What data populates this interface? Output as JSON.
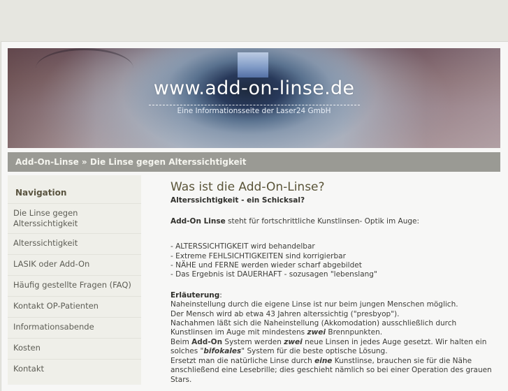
{
  "header": {
    "site_title": "www.add-on-linse.de",
    "site_subtitle": "Eine Informationsseite der Laser24 GmbH"
  },
  "breadcrumb": {
    "text": "Add-On-Linse » Die Linse gegen Alterssichtigkeit"
  },
  "sidebar": {
    "heading": "Navigation",
    "items": [
      {
        "label": "Die Linse gegen Alterssichtigkeit"
      },
      {
        "label": "Alterssichtigkeit"
      },
      {
        "label": "LASIK oder Add-On"
      },
      {
        "label": "Häufig gestellte Fragen (FAQ)"
      },
      {
        "label": "Kontakt OP-Patienten"
      },
      {
        "label": "Informationsabende"
      },
      {
        "label": "Kosten"
      },
      {
        "label": "Kontakt"
      }
    ]
  },
  "main": {
    "title": "Was ist die Add-On-Linse?",
    "subhead": "Alterssichtigkeit - ein Schicksal?",
    "intro_bold": "Add-On Linse",
    "intro_rest": " steht für fortschrittliche Kunstlinsen- Optik im Auge:",
    "bullets": [
      "-  ALTERSSICHTIGKEIT wird behandelbar",
      "-  Extreme FEHLSICHTIGKEITEN sind korrigierbar",
      "-  NÄHE und FERNE werden wieder scharf abgebildet",
      "-  Das Ergebnis ist DAUERHAFT - sozusagen \"lebenslang\""
    ],
    "explanation_label": "Erläuterung",
    "explanation_colon": ":",
    "lines": {
      "l1": "Naheinstellung durch die eigene Linse ist nur beim jungen Menschen möglich.",
      "l2": "Der Mensch wird ab etwa 43 Jahren alterssichtig (\"presbyop\").",
      "l3": "Nachahmen läßt sich die Naheinstellung (Akkomodation) ausschließlich durch",
      "l4a": "Kunstlinsen im Auge mit mindestens ",
      "l4b": "zwei",
      "l4c": " Brennpunkten.",
      "l5a": "Beim ",
      "l5b": "Add-On",
      "l5c": " System werden ",
      "l5d": "zwei",
      "l5e": " neue Linsen in jedes Auge gesetzt. Wir halten ein",
      "l6a": "solches \"",
      "l6b": "bifokales",
      "l6c": "\" System  für die beste optische Lösung.",
      "l7a": "Ersetzt man die natürliche Linse durch ",
      "l7b": "eine",
      "l7c": " Kunstlinse, brauchen sie für die Nähe",
      "l8": "anschließend eine Lesebrille; dies geschieht nämlich so bei einer Operation des grauen",
      "l9": "Stars."
    }
  }
}
